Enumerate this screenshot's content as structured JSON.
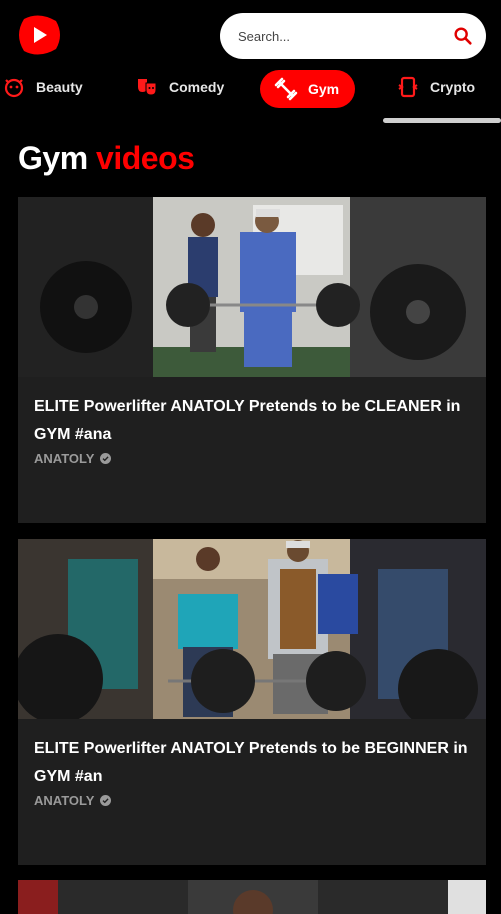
{
  "search": {
    "placeholder": "Search..."
  },
  "categories": [
    {
      "label": "Beauty",
      "icon": "beauty-icon",
      "active": false
    },
    {
      "label": "Comedy",
      "icon": "comedy-masks-icon",
      "active": false
    },
    {
      "label": "Gym",
      "icon": "dumbbell-icon",
      "active": true
    },
    {
      "label": "Crypto",
      "icon": "crypto-icon",
      "active": false
    }
  ],
  "page_title": {
    "main": "Gym",
    "accent": "videos"
  },
  "videos": [
    {
      "title": "ELITE Powerlifter ANATOLY Pretends to be CLEANER in GYM #ana",
      "channel": "ANATOLY",
      "verified": true
    },
    {
      "title": "ELITE Powerlifter ANATOLY Pretends to be BEGINNER in GYM #an",
      "channel": "ANATOLY",
      "verified": true
    }
  ],
  "colors": {
    "accent": "#ff0000",
    "card": "#1f1f1f",
    "background": "#000000"
  }
}
